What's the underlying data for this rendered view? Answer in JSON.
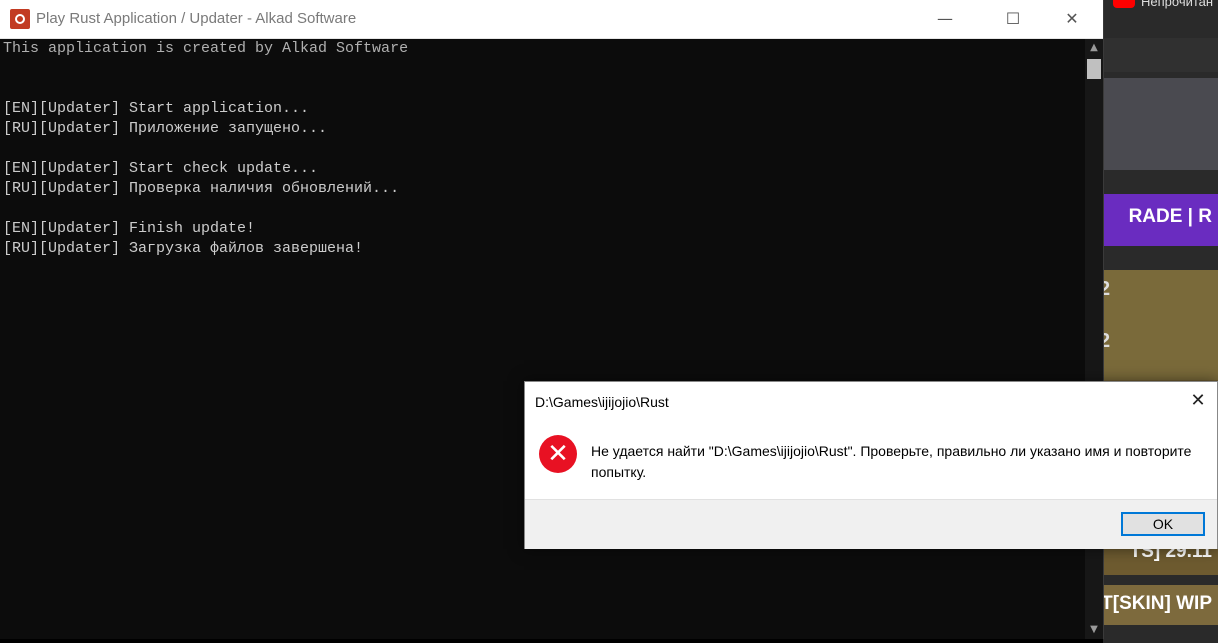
{
  "console": {
    "title": "Play Rust Application / Updater - Alkad Software",
    "controls": {
      "minimize": "—",
      "maximize": "☐",
      "close": "✕"
    },
    "lines": [
      "This application is created by Alkad Software",
      "[EN][Updater] Start application...",
      "[RU][Updater] Приложение запущено...",
      "[EN][Updater] Start check update...",
      "[RU][Updater] Проверка наличия обновлений...",
      "[EN][Updater] Finish update!",
      "[RU][Updater] Загрузка файлов завершена!"
    ],
    "scroll_up": "▲",
    "scroll_down": "▼"
  },
  "dialog": {
    "title": "D:\\Games\\ijijojio\\Rust",
    "close": "✕",
    "message": "Не удается найти \"D:\\Games\\ijijojio\\Rust\". Проверьте, правильно ли указано имя и повторите попытку.",
    "icon": "✕",
    "ok_label": "OK"
  },
  "background": {
    "youtube_text": "Непрочитан",
    "thumb_labels": [
      "RADE | R",
      "2",
      "2",
      "TS] 29.11",
      "T[SKIN] WIP"
    ]
  },
  "colors": {
    "console_bg": "#0c0c0c",
    "console_text": "#cccccc",
    "error_red": "#e81123",
    "focus_blue": "#0078d7"
  }
}
